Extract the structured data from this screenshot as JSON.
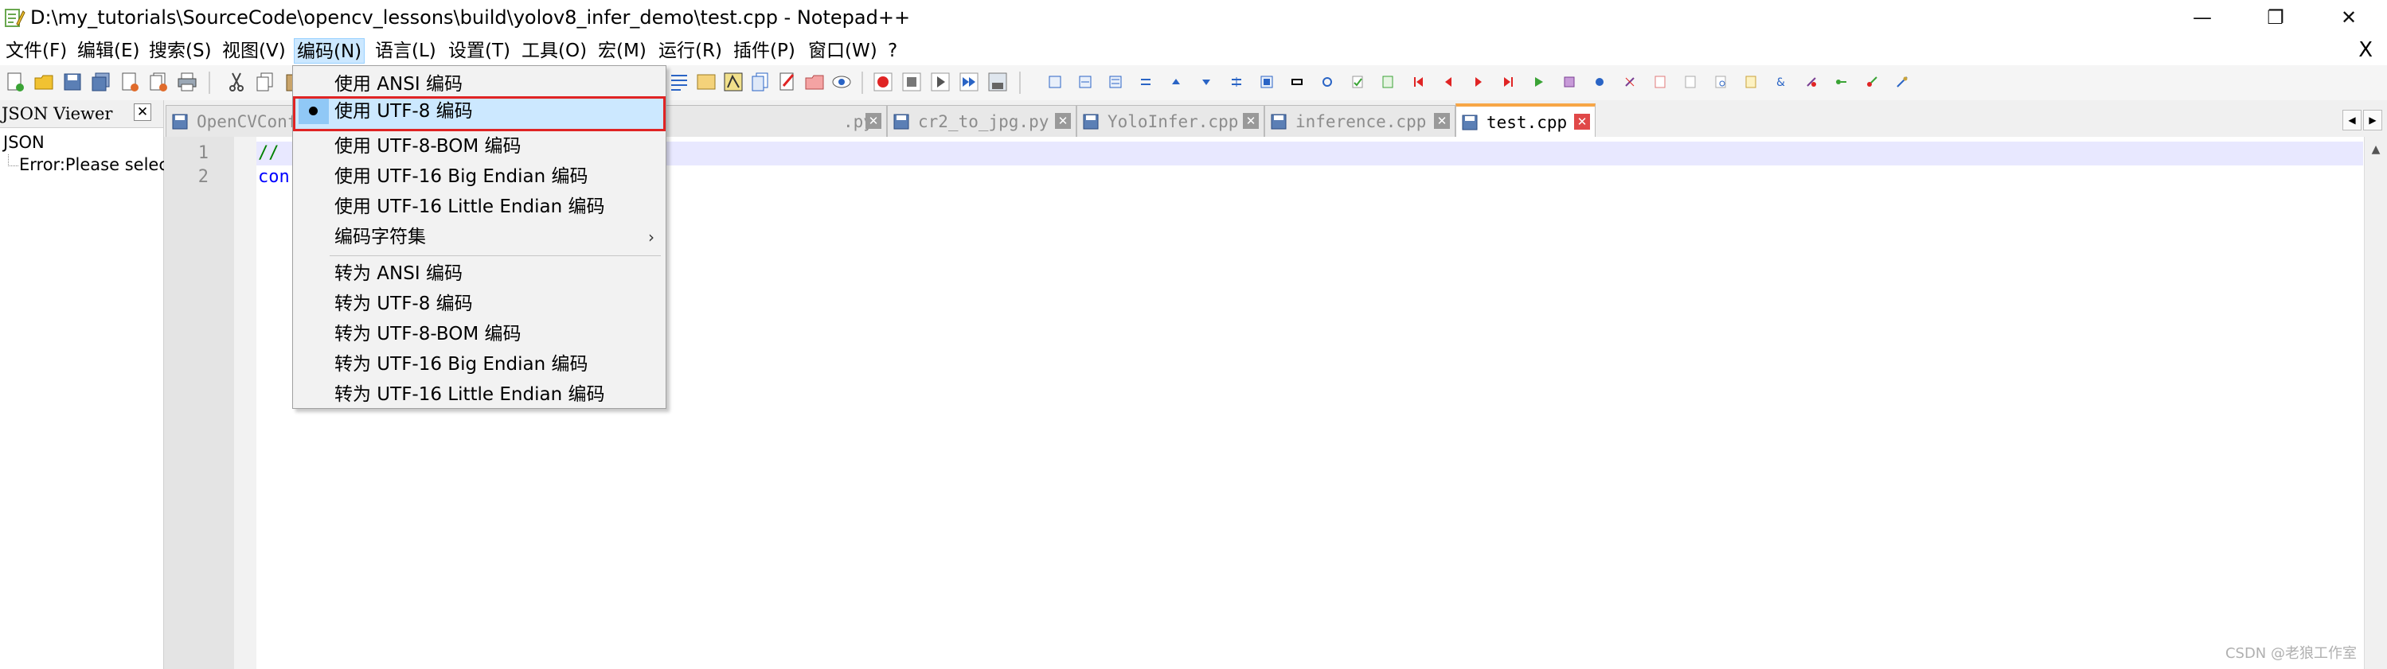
{
  "window": {
    "title": "D:\\my_tutorials\\SourceCode\\opencv_lessons\\build\\yolov8_infer_demo\\test.cpp - Notepad++",
    "minimize_glyph": "—",
    "restore_glyph": "❐",
    "close_glyph": "✕"
  },
  "menubar": {
    "items": [
      {
        "label": "文件(F)"
      },
      {
        "label": "编辑(E)"
      },
      {
        "label": "搜索(S)"
      },
      {
        "label": "视图(V)"
      },
      {
        "label": "编码(N)"
      },
      {
        "label": "语言(L)"
      },
      {
        "label": "设置(T)"
      },
      {
        "label": "工具(O)"
      },
      {
        "label": "宏(M)"
      },
      {
        "label": "运行(R)"
      },
      {
        "label": "插件(P)"
      },
      {
        "label": "窗口(W)"
      },
      {
        "label": "?"
      }
    ],
    "close_label": "X"
  },
  "side_panel": {
    "title": "JSON Viewer",
    "close_glyph": "✕",
    "tree_root": "JSON",
    "tree_child": "Error:Please select"
  },
  "tabs": [
    {
      "label": "OpenCVConf",
      "close_glyph": "✕"
    },
    {
      "label": ".py",
      "close_glyph": "✕"
    },
    {
      "label": "cr2_to_jpg.py",
      "close_glyph": "✕"
    },
    {
      "label": "YoloInfer.cpp",
      "close_glyph": "✕"
    },
    {
      "label": "inference.cpp",
      "close_glyph": "✕"
    },
    {
      "label": "test.cpp",
      "close_glyph": "✕"
    }
  ],
  "tab_scroll": {
    "left": "◀",
    "right": "▶"
  },
  "editor": {
    "lines": [
      {
        "number": "1",
        "text": "//"
      },
      {
        "number": "2",
        "text": "con"
      }
    ],
    "scroll_up": "▲"
  },
  "encoding_menu": {
    "items": [
      {
        "label": "使用 ANSI 编码"
      },
      {
        "label": "使用 UTF-8 编码"
      },
      {
        "label": "使用 UTF-8-BOM 编码"
      },
      {
        "label": "使用 UTF-16 Big Endian 编码"
      },
      {
        "label": "使用 UTF-16 Little Endian 编码"
      },
      {
        "label": "编码字符集",
        "submenu_arrow": "›"
      },
      {
        "label": "转为 ANSI 编码"
      },
      {
        "label": "转为 UTF-8 编码"
      },
      {
        "label": "转为 UTF-8-BOM 编码"
      },
      {
        "label": "转为 UTF-16 Big Endian 编码"
      },
      {
        "label": "转为 UTF-16 Little Endian 编码"
      }
    ]
  },
  "watermark": "CSDN @老狼工作室",
  "colors": {
    "highlight": "#cce8ff",
    "highlight_outline": "#e02424",
    "active_tab_accent": "#f7a646",
    "current_line": "#e8e8ff",
    "comment": "#008000",
    "keyword": "#0000ff"
  }
}
